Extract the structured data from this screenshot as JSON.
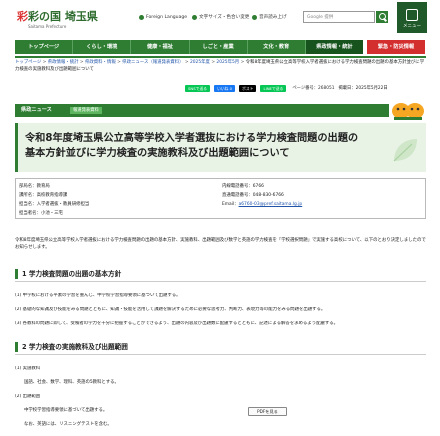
{
  "header": {
    "logo_text": "彩の国 埼玉県",
    "logo_sub": "Saitama Prefecture",
    "links": [
      "Foreign Language",
      "文字サイズ・色合い変更",
      "音声読み上げ"
    ],
    "search_placeholder": "Google 提供",
    "menu_label": "メニュー"
  },
  "nav": {
    "items": [
      "トップページ",
      "くらし・環境",
      "健康・福祉",
      "しごと・産業",
      "文化・教育",
      "県政情報・統計"
    ],
    "active_index": 5,
    "emergency": "緊急・防災情報"
  },
  "breadcrumb": {
    "items": [
      "トップページ",
      "県政情報・統計",
      "県政資料・情報",
      "県政ニュース（報道発表資料）",
      "2025年度",
      "2025年5月",
      "令和8年度埼玉県公立高等学校入学者選抜における学力検査問題の出題の基本方針並びに学力検査の実施教科及び出題範囲について"
    ]
  },
  "share": {
    "buttons": [
      "SNSで送る",
      "いいね 0",
      "ポスト",
      "LINEで送る"
    ],
    "page_number": "ページ番号：268051",
    "updated": "掲載日：2025年5月22日"
  },
  "section_band": {
    "label": "県政ニュース",
    "tag": "報道発表資料"
  },
  "title": "令和8年度埼玉県公立高等学校入学者選抜における学力検査問題の出題の基本方針並びに学力検査の実施教科及び出題範囲について",
  "info": {
    "left": [
      "部局名：教育局",
      "課所名：高校教育指導課",
      "担当名：入学者選抜・教員研修担当",
      "担当者名：小池・三宅"
    ],
    "right_ext": "内線電話番号：6766",
    "right_tel": "直通電話番号：048-830-6766",
    "email_label": "Email：",
    "email": "a6760-03@pref.saitama.lg.jp"
  },
  "intro": "令和8年度埼玉県公立高等学校入学者選抜における学力検査問題の出題の基本方針、実施教科、出題範囲及び数学と英語の学力検査を「学校選択問題」で実施する高校について、以下のとおり決定しましたのでお知らせします。",
  "section1": {
    "heading": "1 学力検査問題の出題の基本方針",
    "items": [
      "(1) 中学校における平素の学習を重んじ、中学校学習指導要領に基づいて出題する。",
      "(2) 基礎的な知識及び技能をみる問題とともに、知識・技能を活用して課題を解決するために必要な思考力、判断力、表現力等の能力をみる問題を出題する。",
      "(3) 各教科の問題に即して、受検者の学力を十分に把握することができるよう、出題の内容及び出題数に配慮するとともに、記述による解答を求めるよう配慮する。"
    ]
  },
  "section2": {
    "heading": "2 学力検査の実施教科及び出題範囲",
    "sub1": "(1) 実施教科",
    "sub1_text": "国語、社会、数学、理科、英語の5教科とする。",
    "sub2": "(2) 出題範囲",
    "sub2_text1": "中学校学習指導要領に基づいて出題する。",
    "sub2_text2": "なお、英語には、リスニングテストを含む。",
    "pdf_button": "PDFを見る"
  },
  "colors": {
    "primary": "#2e7d32",
    "dark": "#17531d",
    "emergency": "#d32f2f",
    "link": "#2255aa",
    "title_bg": "#e8f3e6"
  }
}
